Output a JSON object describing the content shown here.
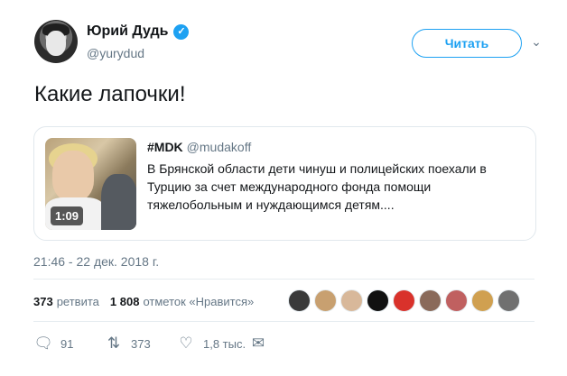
{
  "author": {
    "display_name": "Юрий Дудь",
    "handle": "@yurydud",
    "verified_icon": "✓"
  },
  "follow_button": "Читать",
  "tweet_text": "Какие лапочки!",
  "card": {
    "author": "#MDK",
    "handle": "@mudakoff",
    "text": "В Брянской области дети чинуш и полицейских поехали в Турцию за счет международного фонда помощи тяжелобольным и нуждающимся детям....",
    "video_duration": "1:09"
  },
  "timestamp": "21:46 - 22 дек. 2018 г.",
  "stats": {
    "retweets_count": "373",
    "retweets_label": "ретвита",
    "likes_count": "1 808",
    "likes_label": "отметок «Нравится»"
  },
  "liker_avatars": [
    "#3a3a3a",
    "#c8a070",
    "#d8b89a",
    "#111111",
    "#d9322b",
    "#8a6a5a",
    "#c06060",
    "#d0a050",
    "#707070"
  ],
  "actions": {
    "reply_count": "91",
    "retweet_count": "373",
    "like_count": "1,8 тыс."
  },
  "colors": {
    "accent": "#1da1f2",
    "secondary_text": "#657786",
    "border": "#e1e8ed"
  }
}
